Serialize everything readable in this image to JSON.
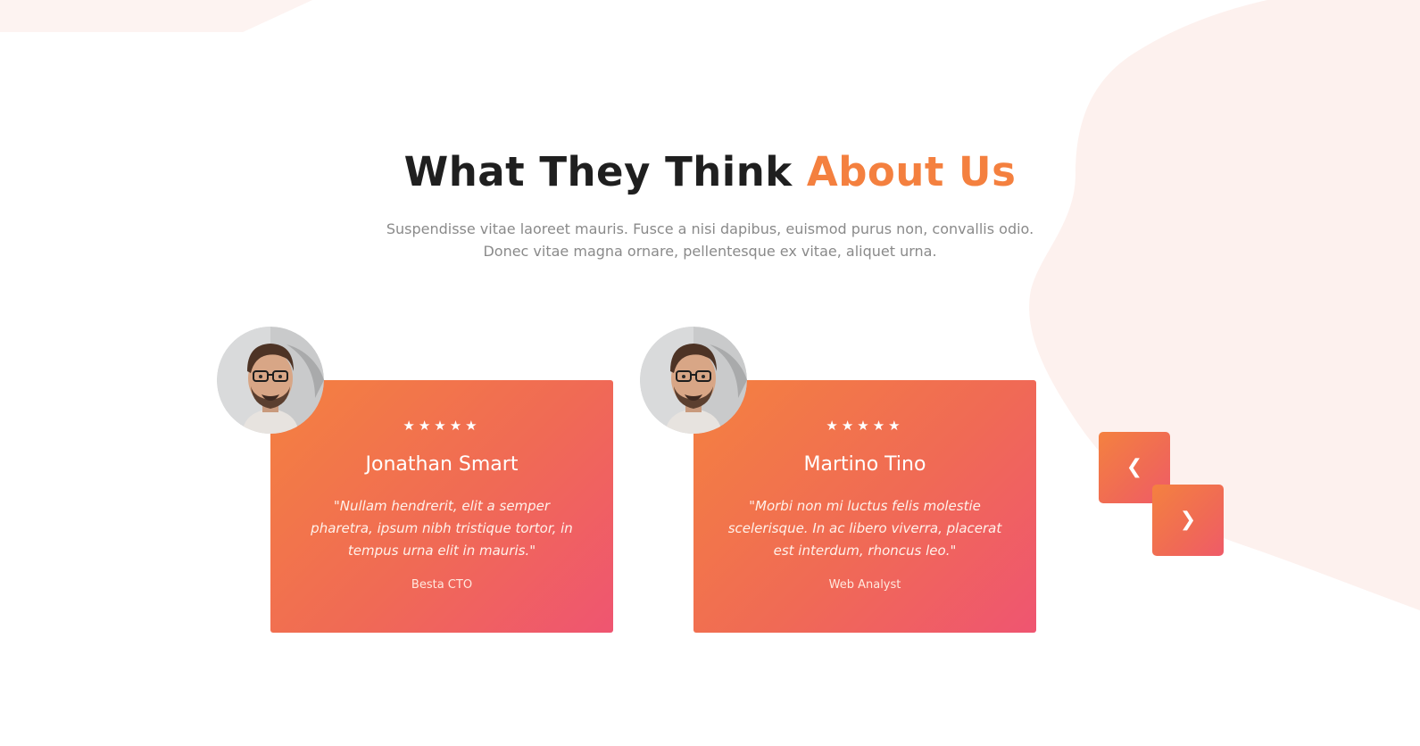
{
  "section": {
    "title_main": "What They Think",
    "title_accent": "About Us",
    "subtitle": "Suspendisse vitae laoreet mauris. Fusce a nisi dapibus, euismod purus non, convallis odio. Donec vitae magna ornare, pellentesque ex vitae, aliquet urna."
  },
  "testimonials": [
    {
      "stars": "★★★★★",
      "rating": 5,
      "name": "Jonathan Smart",
      "quote": "\"Nullam hendrerit, elit a semper pharetra, ipsum nibh tristique tortor, in tempus urna elit in mauris.\"",
      "role": "Besta CTO"
    },
    {
      "stars": "★★★★★",
      "rating": 5,
      "name": "Martino Tino",
      "quote": "\"Morbi non mi luctus felis molestie scelerisque. In ac libero viverra, placerat est interdum, rhoncus leo.\"",
      "role": "Web Analyst"
    }
  ],
  "nav": {
    "prev_glyph": "❮",
    "next_glyph": "❯"
  },
  "colors": {
    "accent": "#f4803f",
    "card_gradient_start": "#f48140",
    "card_gradient_end": "#ef5571",
    "heading": "#1f1f1f",
    "body_text": "#8a8a8a",
    "background_blob": "#fdf1ee"
  },
  "icons": {
    "avatar": "person-avatar",
    "rating": "star-icon",
    "prev": "chevron-left-icon",
    "next": "chevron-right-icon"
  }
}
